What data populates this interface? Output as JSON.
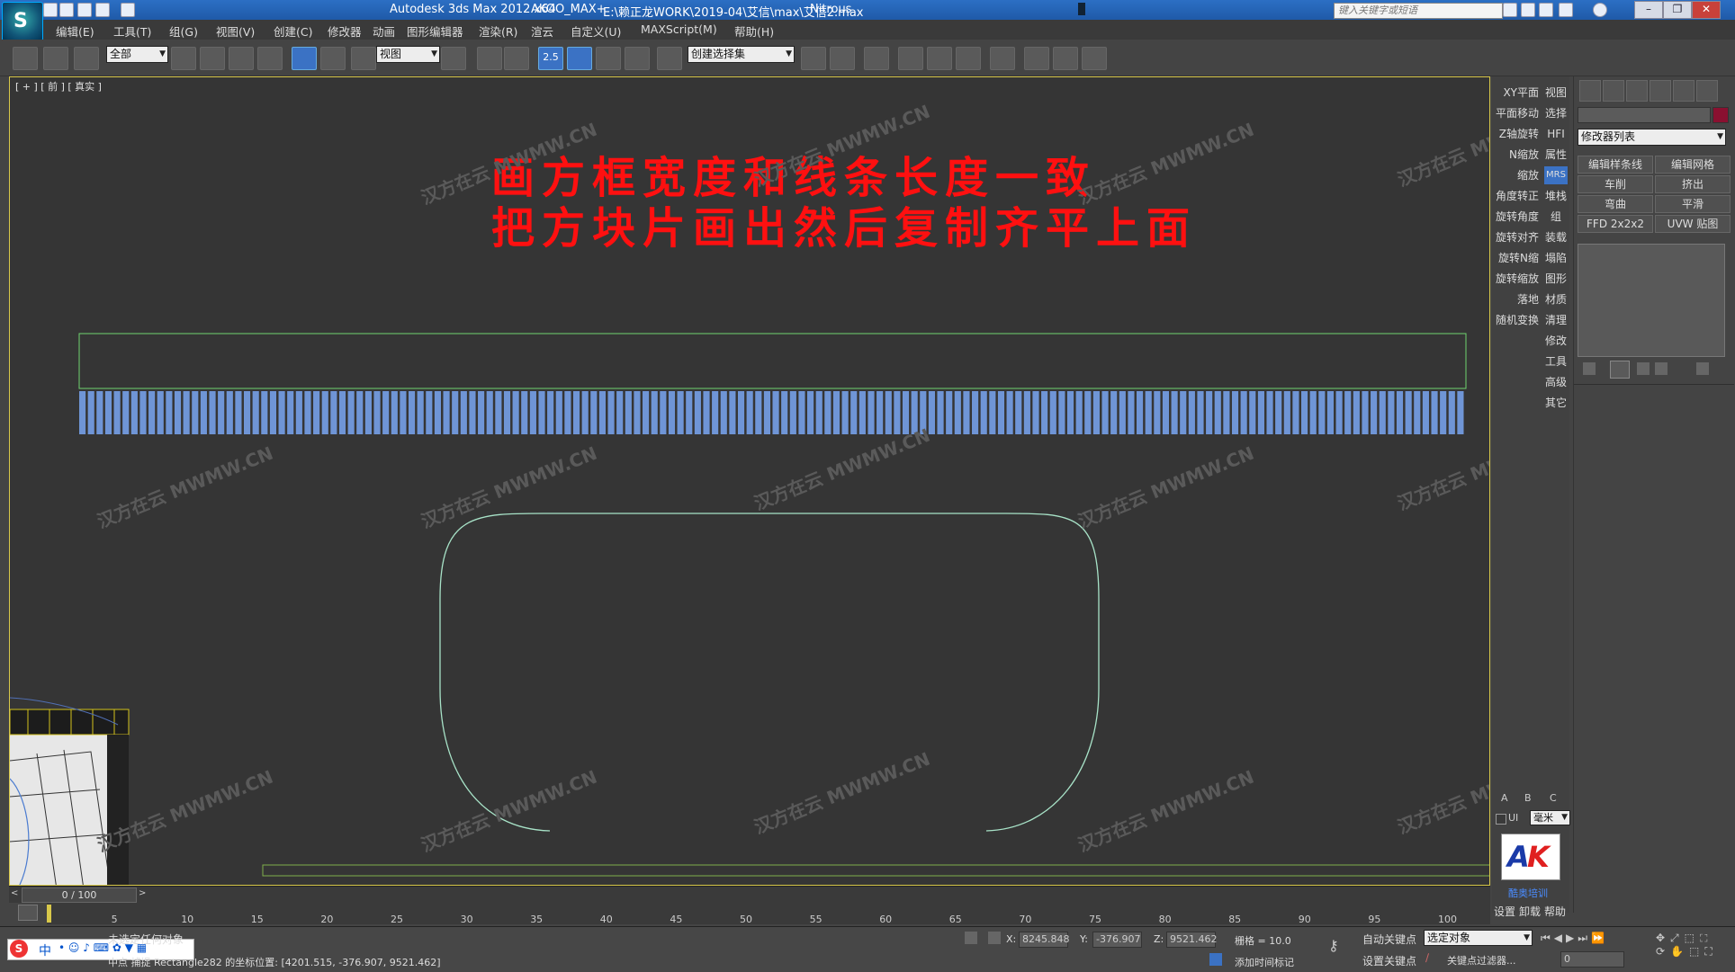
{
  "titlebar": {
    "app": "Autodesk 3ds Max  2012 x64",
    "project": "AKOO_MAX+",
    "file": "E:\\赖正龙WORK\\2019-04\\艾信\\max\\艾信2.max",
    "renderer": "Nitrous",
    "search_placeholder": "键入关键字或短语"
  },
  "menu": [
    "编辑(E)",
    "工具(T)",
    "组(G)",
    "视图(V)",
    "创建(C)",
    "修改器",
    "动画",
    "图形编辑器",
    "渲染(R)",
    "渲云",
    "自定义(U)",
    "MAXScript(M)",
    "帮助(H)"
  ],
  "toolbar": {
    "selection_filter": "全部",
    "ref_coord": "视图",
    "snap_value": "2.5",
    "named_selection": "创建选择集"
  },
  "viewport": {
    "label": "[ + ] [ 前 ] [ 真实 ]",
    "banner_line1": "画方框宽度和线条长度一致",
    "banner_line2": "把方块片画出然后复制齐平上面",
    "watermark": "MWMW.CN",
    "watermark_brand": "汉方在云",
    "slats_count": 160,
    "colors": {
      "slat": "#6f95d6",
      "outline": "#6fd36f",
      "curve": "#a8e3c8",
      "border": "#d8c84a"
    }
  },
  "quickpanel": {
    "left": [
      "XY平面",
      "平面移动",
      "Z轴旋转",
      "N缩放",
      "缩放",
      "角度转正",
      "旋转角度",
      "旋转对齐",
      "旋转N缩",
      "旋转缩放",
      "落地",
      "随机变换"
    ],
    "right": [
      "视图",
      "选择",
      "HFI",
      "属性",
      "MRS",
      "堆栈",
      "组",
      "装载",
      "塌陷",
      "图形",
      "材质",
      "清理",
      "修改",
      "工具",
      "高级",
      "其它"
    ],
    "abc": [
      "A",
      "B",
      "C"
    ],
    "ui_label": "UI",
    "unit": "毫米",
    "logo_caption": "酷奥培训",
    "bottom": [
      "设置",
      "卸载",
      "帮助"
    ]
  },
  "cmdpanel": {
    "modifier_list": "修改器列表",
    "buttons": [
      "编辑样条线",
      "编辑网格",
      "车削",
      "挤出",
      "弯曲",
      "平滑",
      "FFD 2x2x2",
      "UVW 贴图"
    ]
  },
  "timeline": {
    "frame_display": "0 / 100",
    "ticks": [
      "5",
      "10",
      "15",
      "20",
      "25",
      "30",
      "35",
      "40",
      "45",
      "50",
      "55",
      "60",
      "65",
      "70",
      "75",
      "80",
      "85",
      "90",
      "95",
      "100"
    ]
  },
  "status": {
    "selected": "未选定任何对象",
    "prompt": "中点 捕捉 Rectangle282 的坐标位置: [4201.515, -376.907, 9521.462]",
    "x_label": "X:",
    "x": "8245.848",
    "y_label": "Y:",
    "y": "-376.907",
    "z_label": "Z:",
    "z": "9521.462",
    "grid": "栅格 = 10.0",
    "add_time_tag": "添加时间标记",
    "auto_key": "自动关键点",
    "set_key": "设置关键点",
    "key_mode": "选定对象",
    "key_filter": "关键点过滤器...",
    "frame": "0"
  }
}
